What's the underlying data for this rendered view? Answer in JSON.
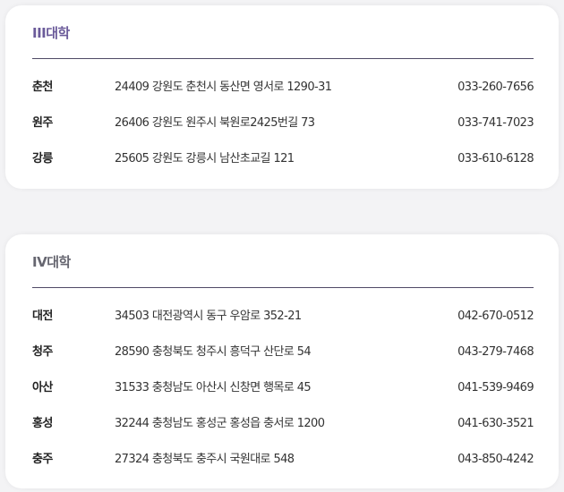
{
  "sections": [
    {
      "title": "III대학",
      "rows": [
        {
          "campus": "춘천",
          "address": "24409 강원도 춘천시 동산면 영서로 1290-31",
          "phone": "033-260-7656"
        },
        {
          "campus": "원주",
          "address": "26406 강원도 원주시 북원로2425번길 73",
          "phone": "033-741-7023"
        },
        {
          "campus": "강릉",
          "address": "25605 강원도 강릉시 남산초교길 121",
          "phone": "033-610-6128"
        }
      ]
    },
    {
      "title": "IV대학",
      "rows": [
        {
          "campus": "대전",
          "address": "34503 대전광역시 동구 우암로 352-21",
          "phone": "042-670-0512"
        },
        {
          "campus": "청주",
          "address": "28590 충청북도 청주시 흥덕구 산단로 54",
          "phone": "043-279-7468"
        },
        {
          "campus": "아산",
          "address": "31533 충청남도 아산시 신창면 행목로 45",
          "phone": "041-539-9469"
        },
        {
          "campus": "홍성",
          "address": "32244 충청남도 홍성군 홍성읍 충서로 1200",
          "phone": "041-630-3521"
        },
        {
          "campus": "충주",
          "address": "27324 충청북도 충주시 국원대로 548",
          "phone": "043-850-4242"
        }
      ]
    }
  ],
  "colors": {
    "title_accent": "#6b5b9a",
    "title_muted": "#666670",
    "divider": "#4f4a66"
  }
}
